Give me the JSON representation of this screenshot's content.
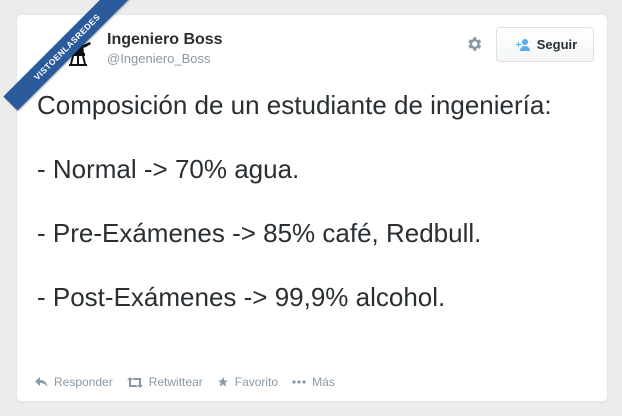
{
  "ribbon": {
    "text": "VISTOENLASREDES"
  },
  "header": {
    "name": "Ingeniero Boss",
    "handle": "@Ingeniero_Boss",
    "follow_label": "Seguir",
    "avatar_icon": "engineer-at-desk-icon",
    "settings_icon": "gear-icon"
  },
  "tweet": {
    "text": "Composición de un estudiante de ingeniería:\n\n- Normal -> 70% agua.\n\n- Pre-Exámenes -> 85% café, Redbull.\n\n- Post-Exámenes -> 99,9% alcohol."
  },
  "actions": {
    "reply": "Responder",
    "retweet": "Retwittear",
    "favorite": "Favorito",
    "more": "Más"
  },
  "colors": {
    "ribbon": "#2b5a9c",
    "text": "#292f33",
    "muted": "#8899a6",
    "follow_icon": "#55acee"
  }
}
